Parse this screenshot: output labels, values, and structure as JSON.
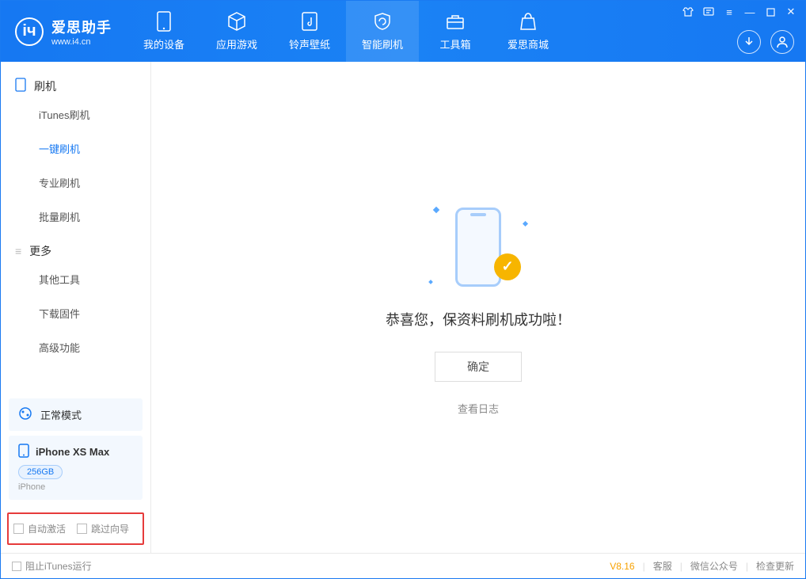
{
  "app": {
    "name_cn": "爱思助手",
    "name_en": "www.i4.cn"
  },
  "nav": [
    {
      "label": "我的设备"
    },
    {
      "label": "应用游戏"
    },
    {
      "label": "铃声壁纸"
    },
    {
      "label": "智能刷机"
    },
    {
      "label": "工具箱"
    },
    {
      "label": "爱思商城"
    }
  ],
  "sidebar": {
    "group1_label": "刷机",
    "items1": [
      {
        "label": "iTunes刷机"
      },
      {
        "label": "一键刷机"
      },
      {
        "label": "专业刷机"
      },
      {
        "label": "批量刷机"
      }
    ],
    "group2_label": "更多",
    "items2": [
      {
        "label": "其他工具"
      },
      {
        "label": "下载固件"
      },
      {
        "label": "高级功能"
      }
    ]
  },
  "mode": {
    "label": "正常模式"
  },
  "device": {
    "name": "iPhone XS Max",
    "capacity": "256GB",
    "type": "iPhone"
  },
  "options": {
    "auto_activate": "自动激活",
    "skip_guide": "跳过向导"
  },
  "main": {
    "success_text": "恭喜您，保资料刷机成功啦！",
    "ok_button": "确定",
    "view_log": "查看日志"
  },
  "footer": {
    "block_itunes": "阻止iTunes运行",
    "version": "V8.16",
    "service": "客服",
    "wechat": "微信公众号",
    "update": "检查更新"
  }
}
